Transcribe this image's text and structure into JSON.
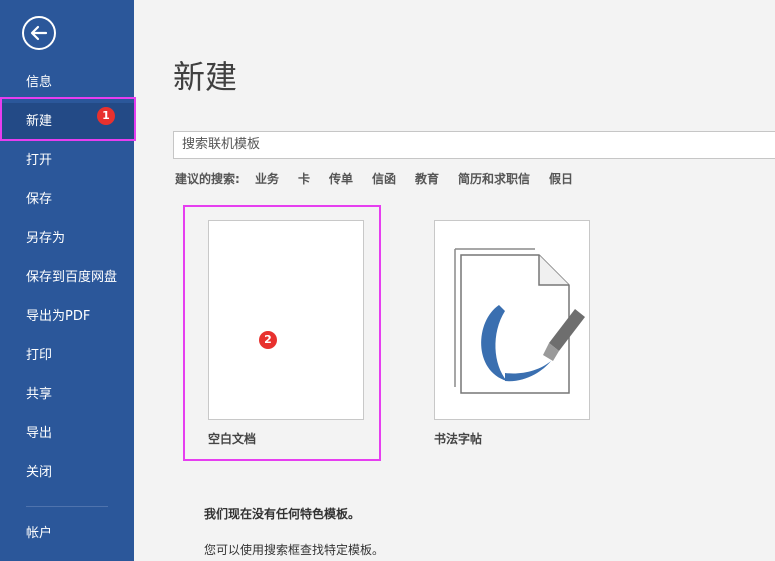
{
  "sidebar": {
    "items": [
      {
        "label": "信息"
      },
      {
        "label": "新建"
      },
      {
        "label": "打开"
      },
      {
        "label": "保存"
      },
      {
        "label": "另存为"
      },
      {
        "label": "保存到百度网盘"
      },
      {
        "label": "导出为PDF"
      },
      {
        "label": "打印"
      },
      {
        "label": "共享"
      },
      {
        "label": "导出"
      },
      {
        "label": "关闭"
      },
      {
        "label": "帐户"
      }
    ]
  },
  "main": {
    "title": "新建",
    "search_placeholder": "搜索联机模板",
    "suggest_label": "建议的搜索:",
    "suggestions": [
      "业务",
      "卡",
      "传单",
      "信函",
      "教育",
      "简历和求职信",
      "假日"
    ],
    "templates": [
      {
        "label": "空白文档"
      },
      {
        "label": "书法字帖"
      }
    ],
    "message_bold": "我们现在没有任何特色模板。",
    "message": "您可以使用搜索框查找特定模板。"
  },
  "annotations": {
    "badge1": "1",
    "badge2": "2"
  },
  "colors": {
    "sidebar": "#2b579a",
    "highlight": "#e63ef0",
    "badge": "#e8312e"
  }
}
